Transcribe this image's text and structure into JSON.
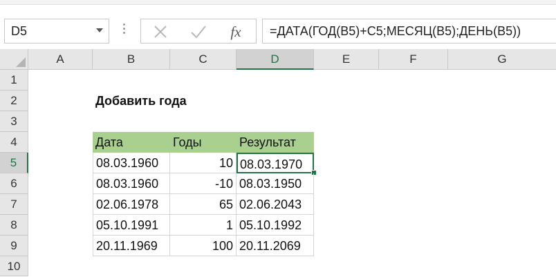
{
  "name_box": {
    "value": "D5"
  },
  "formula_bar": {
    "fx_label": "fx",
    "formula": "=ДАТА(ГОД(B5)+C5;МЕСЯЦ(B5);ДЕНЬ(B5))"
  },
  "columns": [
    "A",
    "B",
    "C",
    "D",
    "E",
    "F",
    "G"
  ],
  "rows": [
    "1",
    "2",
    "3",
    "4",
    "5",
    "6",
    "7",
    "8",
    "9",
    "10"
  ],
  "selected_column": "D",
  "selected_row": "5",
  "sheet": {
    "title": "Добавить года",
    "table": {
      "headers": [
        "Дата",
        "Годы",
        "Результат"
      ],
      "rows": [
        [
          "08.03.1960",
          "10",
          "08.03.1970"
        ],
        [
          "08.03.1960",
          "-10",
          "08.03.1950"
        ],
        [
          "02.06.1978",
          "65",
          "02.06.2043"
        ],
        [
          "05.10.1991",
          "1",
          "05.10.1992"
        ],
        [
          "20.11.1969",
          "100",
          "20.11.2069"
        ]
      ],
      "header_color": "#a9d08e"
    }
  },
  "accent_color": "#217346",
  "icons": [
    "dropdown-arrow-icon",
    "cancel-x-icon",
    "enter-check-icon",
    "fx-icon",
    "select-all-icon"
  ]
}
